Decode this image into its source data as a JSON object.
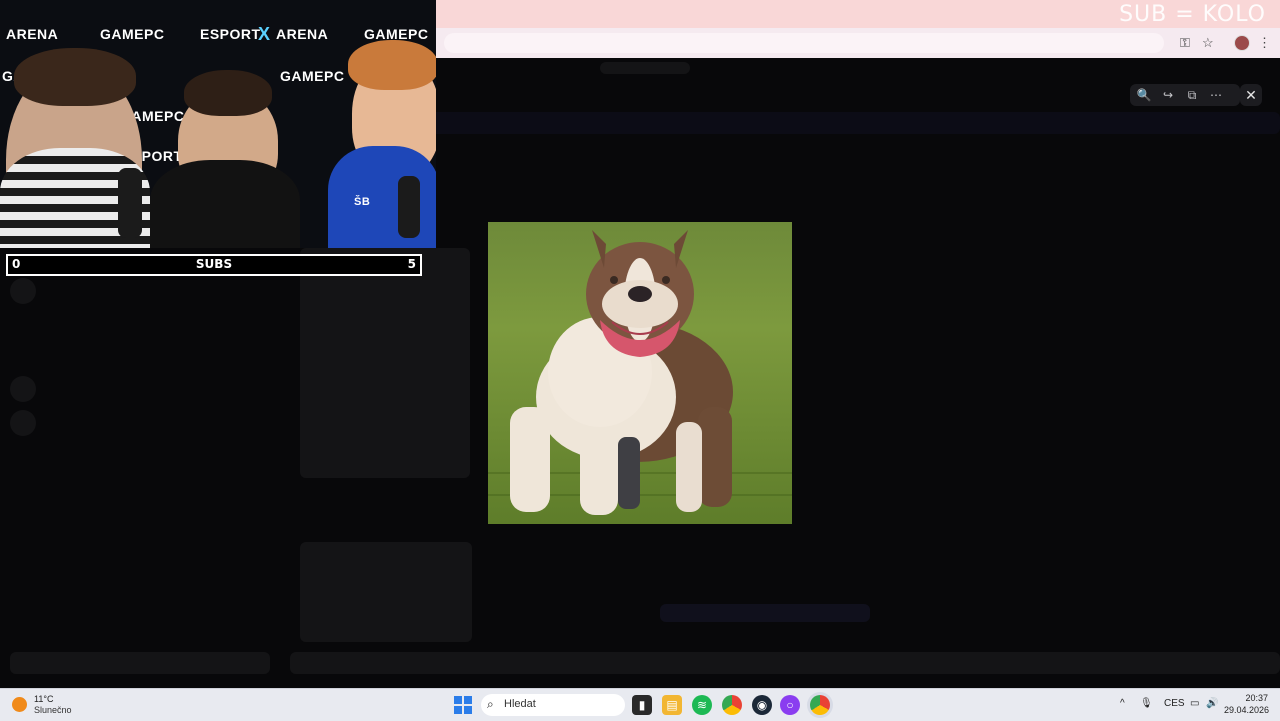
{
  "overlay": {
    "sub_goal_text": "SUB = KOLO",
    "subs": {
      "label": "SUBS",
      "current": "0",
      "goal": "5",
      "progress": 0.0
    },
    "webcam_banner": [
      "ARENA",
      "GAMEPC",
      "ESPORT",
      "ARENA",
      "GAMEPC"
    ],
    "jersey_initials": "ŠB"
  },
  "browser": {
    "title_bar_color": "#f9d7d7",
    "icons": [
      "key-icon",
      "star-icon",
      "profile-avatar",
      "more-vert-icon"
    ]
  },
  "viewer": {
    "toolbar": {
      "zoom_label": "🔍",
      "forward_label": "↪",
      "open_external_label": "⧉",
      "more_label": "⋯",
      "close_label": "✕"
    },
    "image_alt": "Dog photo"
  },
  "taskbar": {
    "weather": {
      "temp": "11°C",
      "condition": "Slunečno"
    },
    "search_placeholder": "Hledat",
    "apps": [
      "file-explorer-icon",
      "files-icon",
      "spotify-icon",
      "chrome-icon",
      "steam-icon",
      "twitch-icon",
      "chrome-active-icon"
    ],
    "tray": {
      "chevron": "^",
      "mic": "🎙",
      "language": "CES",
      "monitor": "▭",
      "volume": "🔊"
    },
    "clock": {
      "time": "20:37",
      "date": "29.04.2026"
    }
  }
}
